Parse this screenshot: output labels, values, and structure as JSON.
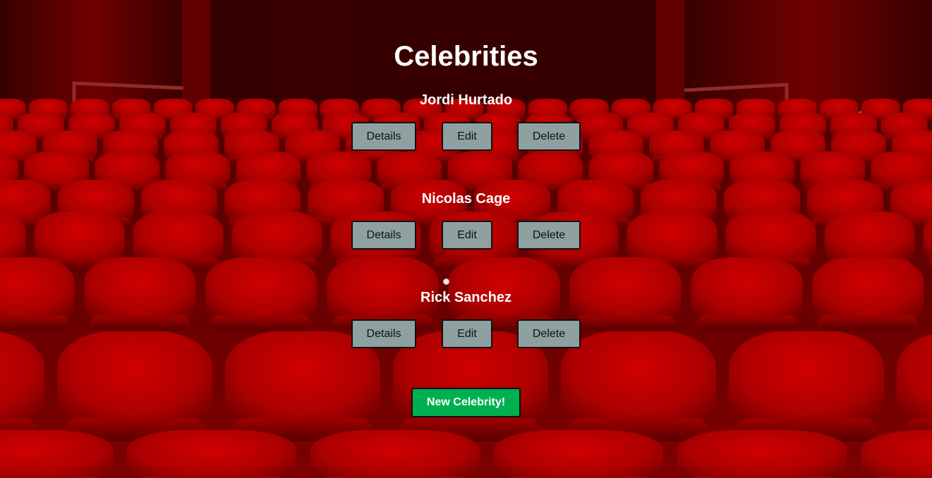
{
  "page": {
    "title": "Celebrities"
  },
  "celebrities": [
    {
      "name": "Jordi Hurtado",
      "details_label": "Details",
      "edit_label": "Edit",
      "delete_label": "Delete"
    },
    {
      "name": "Nicolas Cage",
      "details_label": "Details",
      "edit_label": "Edit",
      "delete_label": "Delete"
    },
    {
      "name": "Rick Sanchez",
      "details_label": "Details",
      "edit_label": "Edit",
      "delete_label": "Delete"
    }
  ],
  "actions": {
    "new_celebrity_label": "New Celebrity!"
  },
  "colors": {
    "text": "#ffffff",
    "action_button_bg": "#8fa0a0",
    "new_button_bg": "#00b050",
    "seat_red": "#c80000"
  },
  "background": {
    "icon": "theater-seats-backdrop"
  }
}
